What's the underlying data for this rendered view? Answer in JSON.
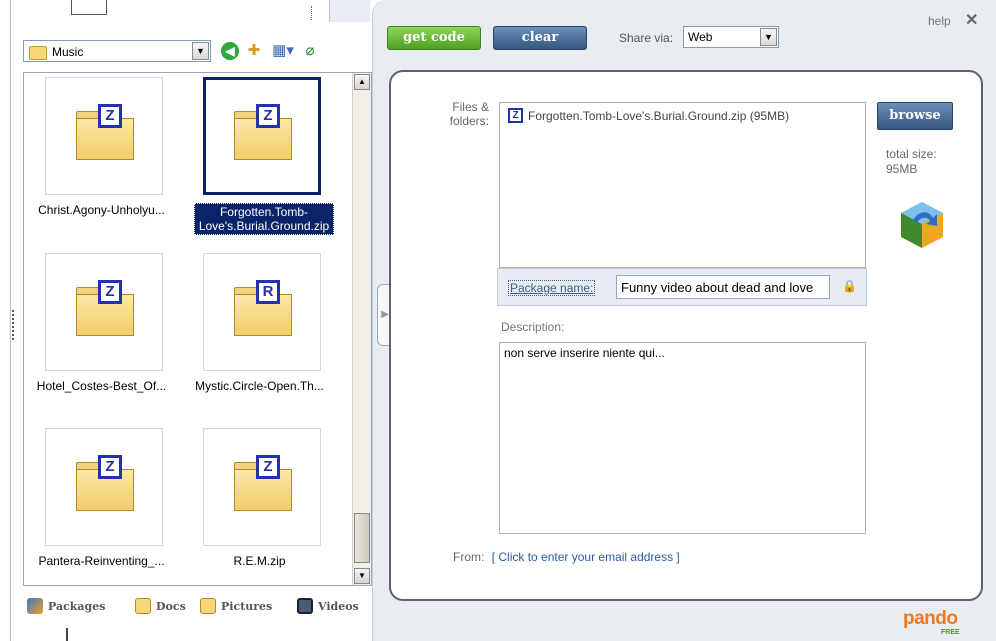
{
  "browser": {
    "folder": "Music",
    "items": [
      {
        "caption": "Christ.Agony-Unholyu...",
        "badge": "Z"
      },
      {
        "caption": "Forgotten.Tomb-Love's.Burial.Ground.zip",
        "badge": "Z"
      },
      {
        "caption": "Hotel_Costes-Best_Of...",
        "badge": "Z"
      },
      {
        "caption": "Mystic.Circle-Open.Th...",
        "badge": "R"
      },
      {
        "caption": "Pantera-Reinventing_...",
        "badge": "Z"
      },
      {
        "caption": "R.E.M.zip",
        "badge": "Z"
      }
    ],
    "tabs": [
      "Packages",
      "Docs",
      "Pictures",
      "Videos"
    ]
  },
  "toolbar": {
    "get_code": "get code",
    "clear": "clear",
    "share_label": "Share via:",
    "share_value": "Web",
    "help": "help",
    "close": "✕"
  },
  "form": {
    "files_label": "Files & folders:",
    "file": "Forgotten.Tomb-Love's.Burial.Ground.zip (95MB)",
    "browse": "browse",
    "total_size_label": "total size:",
    "total_size_value": "95MB",
    "package_name_label": "Package name:",
    "package_name_value": "Funny video about dead and love",
    "description_label": "Description:",
    "description_value": "non serve inserire niente qui...",
    "from_label": "From:",
    "from_link": "[ Click to enter your email address ]"
  },
  "logo": {
    "word": "pando",
    "badge": "FREE"
  },
  "colors": {
    "accent_green": "#4e9f22",
    "accent_blue": "#33577f",
    "selection": "#0a246a",
    "logo_orange": "#f07a1e"
  }
}
